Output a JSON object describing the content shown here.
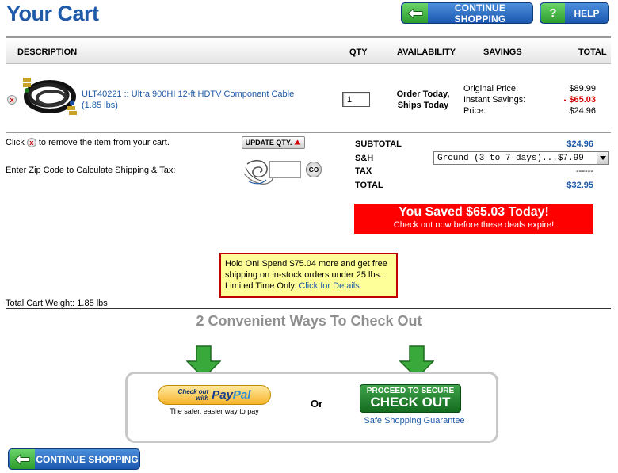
{
  "page": {
    "title": "Your Cart"
  },
  "top_buttons": {
    "continue_shopping": "CONTINUE SHOPPING",
    "help": "HELP",
    "help_glyph": "?"
  },
  "table": {
    "headers": [
      "DESCRIPTION",
      "QTY",
      "AVAILABILITY",
      "SAVINGS",
      "TOTAL"
    ]
  },
  "item": {
    "sku_title": "ULT40221 :: Ultra 900HI 12-ft HDTV Component Cable",
    "weight": "(1.85 lbs)",
    "qty": "1",
    "availability_line1": "Order Today,",
    "availability_line2": "Ships Today",
    "original_price_label": "Original Price:",
    "original_price": "$89.99",
    "instant_savings_label": "Instant Savings:",
    "instant_savings": "- $65.03",
    "price_label": "Price:",
    "price": "$24.96"
  },
  "cart_actions": {
    "remove_hint_before": "Click",
    "remove_hint_after": "to remove the item from your cart.",
    "update_qty": "UPDATE QTY.",
    "zip_label": "Enter Zip Code to Calculate Shipping & Tax:",
    "go": "GO",
    "remove_glyph": "x"
  },
  "totals": {
    "subtotal_label": "SUBTOTAL",
    "subtotal": "$24.96",
    "sh_label": "S&H",
    "shipping_option": "Ground (3 to 7 days)...$7.99",
    "tax_label": "TAX",
    "tax": "------",
    "total_label": "TOTAL",
    "total": "$32.95"
  },
  "saved_banner": {
    "headline": "You Saved $65.03 Today!",
    "subline": "Check out now before these deals expire!"
  },
  "promo": {
    "text": "Hold On! Spend $75.04 more and get free shipping on in-stock orders under 25 lbs. Limited Time Only.",
    "link": "Click for Details."
  },
  "cart_weight": "Total Cart Weight: 1.85 lbs",
  "checkout": {
    "title": "2 Convenient Ways To Check Out",
    "paypal_check_out": "Check out",
    "paypal_with": "with",
    "paypal_pay": "Pay",
    "paypal_pal": "Pal",
    "paypal_tagline": "The safer, easier way to pay",
    "or": "Or",
    "secure_line1": "PROCEED TO SECURE",
    "secure_line2": "CHECK OUT",
    "safe_link": "Safe Shopping Guarantee"
  },
  "bottom_buttons": {
    "continue_shopping": "CONTINUE SHOPPING"
  },
  "colors": {
    "brand_blue": "#1f5aa8",
    "alert_red": "#ff0000",
    "promo_yellow": "#ffff99",
    "button_green": "#2c9c2c"
  }
}
